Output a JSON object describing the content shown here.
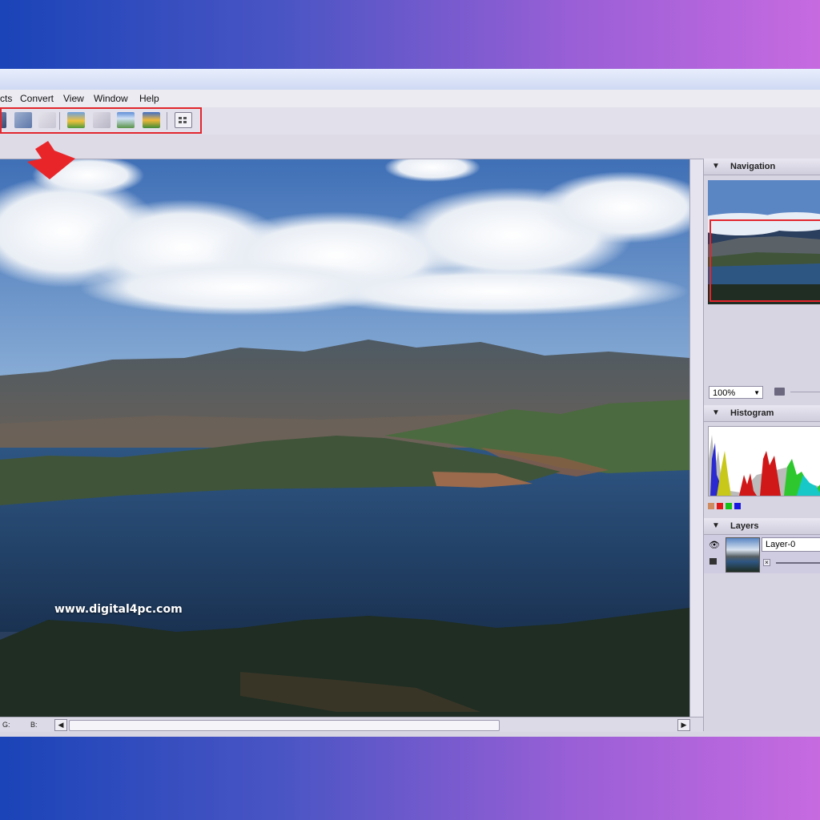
{
  "menu": {
    "items": [
      "cts",
      "Convert",
      "View",
      "Window",
      "Help"
    ]
  },
  "navigation": {
    "title": "Navigation",
    "zoom": "100%"
  },
  "histogram": {
    "title": "Histogram"
  },
  "layers": {
    "title": "Layers",
    "layer_name": "Layer-0"
  },
  "status": {
    "g_label": "G:",
    "b_label": "B:"
  },
  "watermark": "www.digital4pc.com",
  "colors": {
    "highlight": "#e2262d",
    "arrow": "#e8262a"
  }
}
